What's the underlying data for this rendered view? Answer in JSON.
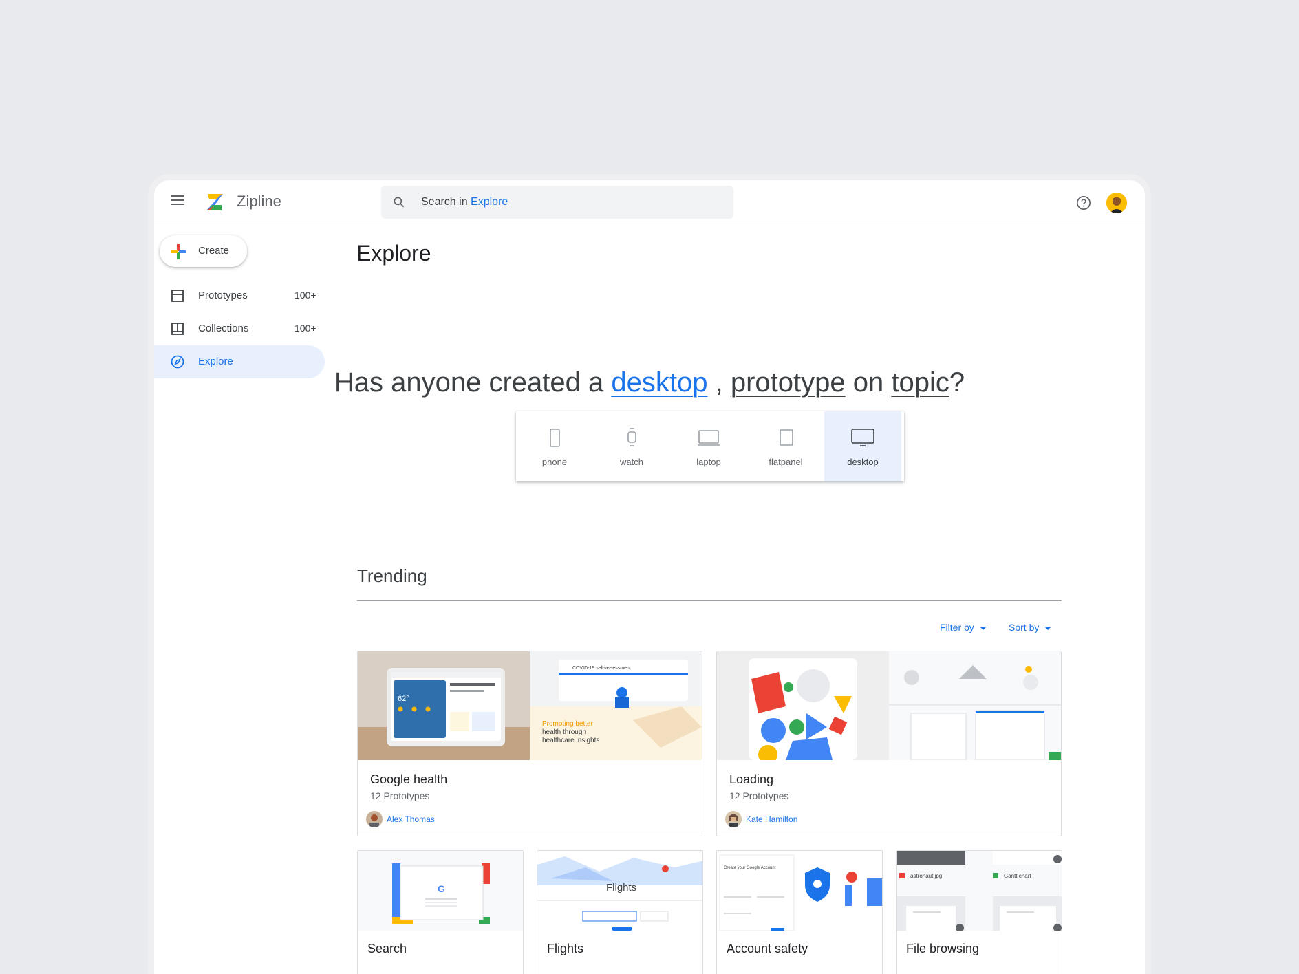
{
  "app": {
    "name": "Zipline"
  },
  "search": {
    "prefix": "Search in",
    "scope": "Explore"
  },
  "sidebar": {
    "create_label": "Create",
    "items": [
      {
        "label": "Prototypes",
        "count": "100+",
        "icon": "prototypes-icon"
      },
      {
        "label": "Collections",
        "count": "100+",
        "icon": "collections-icon"
      },
      {
        "label": "Explore",
        "count": "",
        "icon": "compass-icon",
        "active": true
      }
    ]
  },
  "main": {
    "title": "Explore",
    "headline": {
      "prefix": "Has anyone created a",
      "device_link": "desktop",
      "separator": ",",
      "type_link": "prototype",
      "middle": "on",
      "topic_link": "topic",
      "suffix": "?"
    },
    "devices": [
      {
        "label": "phone",
        "icon": "phone-icon"
      },
      {
        "label": "watch",
        "icon": "watch-icon"
      },
      {
        "label": "laptop",
        "icon": "laptop-icon"
      },
      {
        "label": "flatpanel",
        "icon": "flatpanel-icon"
      },
      {
        "label": "desktop",
        "icon": "desktop-icon",
        "selected": true
      }
    ],
    "trending": {
      "title": "Trending",
      "filter_label": "Filter by",
      "sort_label": "Sort by",
      "cards": [
        {
          "title": "Google health",
          "subtitle": "12 Prototypes",
          "owner": "Alex Thomas",
          "image_text": "Promoting better health through healthcare insights",
          "image_header": "COVID-19 self-assessment",
          "image_temp": "62°"
        },
        {
          "title": "Loading",
          "subtitle": "12 Prototypes",
          "owner": "Kate Hamilton"
        },
        {
          "title": "Search"
        },
        {
          "title": "Flights",
          "image_text": "Flights"
        },
        {
          "title": "Account safety",
          "image_text": "Create your Google Account"
        },
        {
          "title": "File browsing",
          "file_a": "astronaut.jpg",
          "file_b": "Gantt chart"
        }
      ]
    }
  },
  "colors": {
    "accent": "#1a73e8",
    "active_bg": "#e8f0fe",
    "page_bg": "#e8eaed",
    "google_blue": "#4285f4",
    "google_red": "#ea4335",
    "google_yellow": "#fbbc04",
    "google_green": "#34a853"
  }
}
